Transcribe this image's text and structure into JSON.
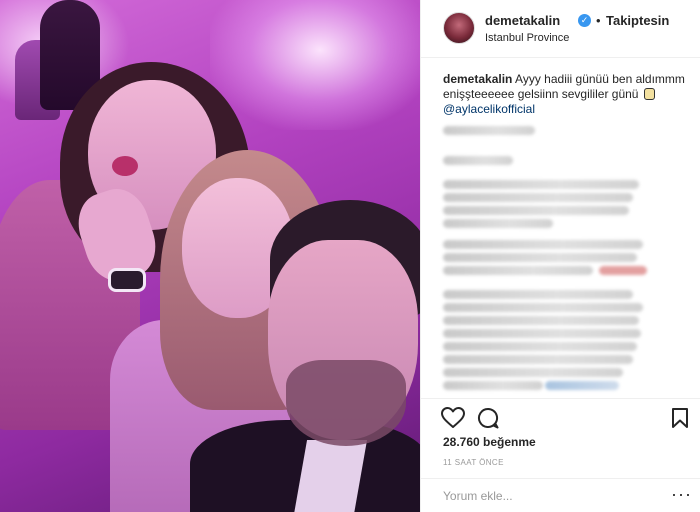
{
  "post": {
    "username": "demetakalin",
    "follow_status": "Takiptesin",
    "location": "Istanbul Province",
    "caption_user": "demetakalin",
    "caption_text": "Ayyy hadiii günüü ben aldımmm enişşteeeeee gelsiinn sevgililer günü",
    "caption_mention": "@aylacelikofficial",
    "likes": "28.760 beğenme",
    "time": "11 SAAT ÖNCE",
    "comment_placeholder": "Yorum ekle...",
    "more_glyph": "···",
    "verified_glyph": "✓",
    "separator": "•"
  },
  "icons": {
    "like": "heart-icon",
    "comment": "comment-icon",
    "save": "bookmark-icon",
    "verified": "verified-badge-icon"
  },
  "colors": {
    "accent_blue": "#3897f0",
    "mention": "#003569",
    "muted_text": "#999999"
  }
}
